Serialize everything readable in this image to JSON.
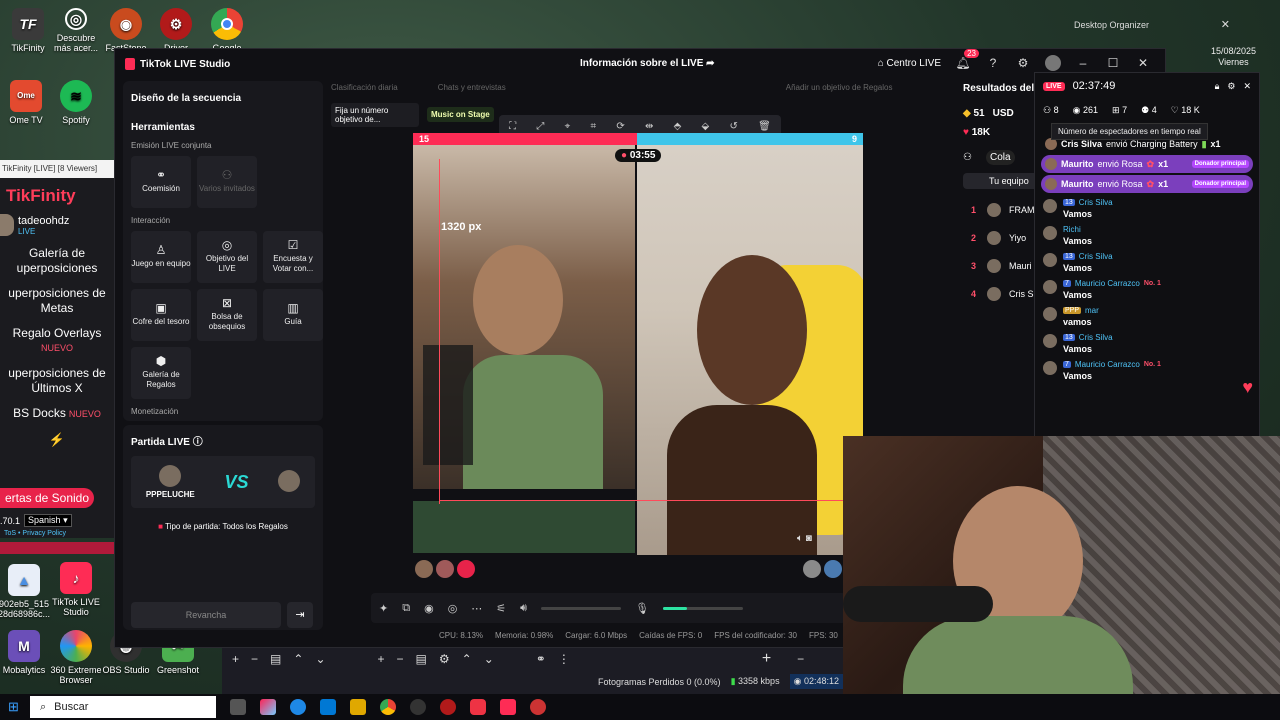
{
  "desktop": {
    "icons": [
      {
        "label": "TikFinity",
        "icon": "tikfinity-icon",
        "color": "#3a3a3a"
      },
      {
        "label": "Descubre más acer...",
        "icon": "compass-icon",
        "color": "#2a2a2a"
      },
      {
        "label": "FastStone Im...",
        "icon": "eye-icon",
        "color": "#c94b1e"
      },
      {
        "label": "Driver",
        "icon": "driver-icon",
        "color": "#b11a1a"
      },
      {
        "label": "Google",
        "icon": "chrome-icon",
        "color": "#e8eaed"
      },
      {
        "label": "Ome TV",
        "icon": "ometv-icon",
        "color": "#e34a2f"
      },
      {
        "label": "Spotify",
        "icon": "spotify-icon",
        "color": "#1db954"
      },
      {
        "label": "902eb5_515 28d68986c...",
        "icon": "image-file-icon",
        "color": "#4b8fe2"
      },
      {
        "label": "TikTok LIVE Studio",
        "icon": "tiktok-icon",
        "color": "#fe2c55"
      },
      {
        "label": "Mobalytics",
        "icon": "mobalytics-icon",
        "color": "#6b4fb8"
      },
      {
        "label": "360 Extreme Browser",
        "icon": "browser-icon",
        "color": "#e9456a"
      },
      {
        "label": "OBS Studio",
        "icon": "obs-icon",
        "color": "#303030"
      },
      {
        "label": "Greenshot",
        "icon": "greenshot-icon",
        "color": "#4caf50"
      }
    ],
    "organizer": "Desktop Organizer",
    "clock_date": "15/08/2025",
    "clock_day": "Viernes"
  },
  "tikfinity": {
    "window_title": "TikFinity [LIVE] [8 Viewers]",
    "brand": "TikFinity",
    "username": "tadeoohdz",
    "status": "LIVE",
    "nav": [
      {
        "label": "Galería de\nuperposiciones",
        "new": ""
      },
      {
        "label": "uperposiciones de\nMetas",
        "new": ""
      },
      {
        "label": "Regalo Overlays",
        "new": "NUEVO"
      },
      {
        "label": "uperposiciones de\nÚltimos X",
        "new": ""
      },
      {
        "label": "BS Docks",
        "new": "NUEVO"
      }
    ],
    "alerts_button": "ertas de Sonido",
    "version": ".70.1",
    "language": "Spanish",
    "tos": "ToS",
    "privacy": "Privacy Policy"
  },
  "studio": {
    "app_title": "TikTok LIVE Studio",
    "center_title": "Información sobre el LIVE",
    "centro_live": "Centro LIVE",
    "notif_count": "23",
    "sequence_title": "Diseño de la secuencia",
    "tools_title": "Herramientas",
    "sec_joint": "Emisión LIVE conjunta",
    "sec_interaction": "Interacción",
    "sec_monetization": "Monetización",
    "tools_joint": [
      {
        "label": "Coemisión",
        "icon": "link-icon",
        "dim": false
      },
      {
        "label": "Varios invitados",
        "icon": "users-icon",
        "dim": true
      }
    ],
    "tools_interaction": [
      {
        "label": "Juego en equipo",
        "icon": "joystick-icon"
      },
      {
        "label": "Objetivo del LIVE",
        "icon": "target-icon"
      },
      {
        "label": "Encuesta y Votar con...",
        "icon": "poll-icon"
      },
      {
        "label": "Cofre del tesoro",
        "icon": "chest-icon"
      },
      {
        "label": "Bolsa de obsequios",
        "icon": "bag-icon"
      },
      {
        "label": "Guía",
        "icon": "book-icon"
      },
      {
        "label": "Galería de Regalos",
        "icon": "gift-gallery-icon"
      }
    ],
    "partida_title": "Partida LIVE",
    "player1": "PPPELUCHE",
    "vs": "VS",
    "match_type": "Tipo de partida: Todos los Regalos",
    "rematch": "Revancha",
    "preview_tabs": [
      "Clasificación diaria",
      "Chats y entrevistas",
      "Añadir un objetivo de Regalos"
    ],
    "pin_tag": "Fija un número objetivo de...",
    "music_tag": "Music on Stage",
    "score_left": "15",
    "score_right": "9",
    "timer": "03:55",
    "measure": "1320 px",
    "stats": {
      "cpu": "CPU: 8.13%",
      "mem": "Memoria: 0.98%",
      "load": "Cargar: 6.0 Mbps",
      "drops": "Caídas de FPS: 0",
      "enc": "FPS del codificador: 30",
      "fps": "FPS: 30"
    },
    "volume": 0.3
  },
  "results": {
    "title": "Resultados del",
    "coins": "51",
    "currency": "USD",
    "likes": "18K",
    "collab": "Cola",
    "team": "Tu equipo",
    "ranks": [
      {
        "n": "1",
        "name": "FRAM"
      },
      {
        "n": "2",
        "name": "Yiyo"
      },
      {
        "n": "3",
        "name": "Mauri"
      },
      {
        "n": "4",
        "name": "Cris Si"
      }
    ]
  },
  "chat": {
    "live": "LIVE",
    "duration": "02:37:49",
    "viewers_now": "8",
    "views": "261",
    "gifts": "7",
    "followers": "4",
    "likes": "18 K",
    "tooltip": "Número de espectadores en tiempo real",
    "events": [
      {
        "user": "Cris Silva",
        "text": "envió Charging Battery",
        "count": "x1",
        "highlight": false,
        "donor": ""
      },
      {
        "user": "Maurito",
        "text": "envió Rosa",
        "count": "x1",
        "highlight": true,
        "donor": "Donador principal"
      },
      {
        "user": "Maurito",
        "text": "envió Rosa",
        "count": "x1",
        "highlight": true,
        "donor": "Donador principal"
      }
    ],
    "messages": [
      {
        "level": "13",
        "user": "Cris Silva",
        "text": "Vamos",
        "badge": "",
        "gold": false
      },
      {
        "level": "",
        "user": "Richi",
        "text": "Vamos",
        "badge": "",
        "gold": false
      },
      {
        "level": "13",
        "user": "Cris Silva",
        "text": "Vamos",
        "badge": "",
        "gold": false
      },
      {
        "level": "7",
        "user": "Mauricio Carrazco",
        "text": "Vamos",
        "badge": "No. 1",
        "gold": false
      },
      {
        "level": "PPP",
        "user": "mar",
        "text": "vamos",
        "badge": "",
        "gold": true
      },
      {
        "level": "13",
        "user": "Cris Silva",
        "text": "Vamos",
        "badge": "",
        "gold": false
      },
      {
        "level": "7",
        "user": "Mauricio Carrazco",
        "text": "Vamos",
        "badge": "No. 1",
        "gold": false
      }
    ]
  },
  "obs": {
    "dropped": "Fotogramas Perdidos 0 (0.0%)",
    "bitrate": "3358 kbps",
    "time": "02:48:12"
  },
  "taskbar": {
    "search": "Buscar"
  }
}
